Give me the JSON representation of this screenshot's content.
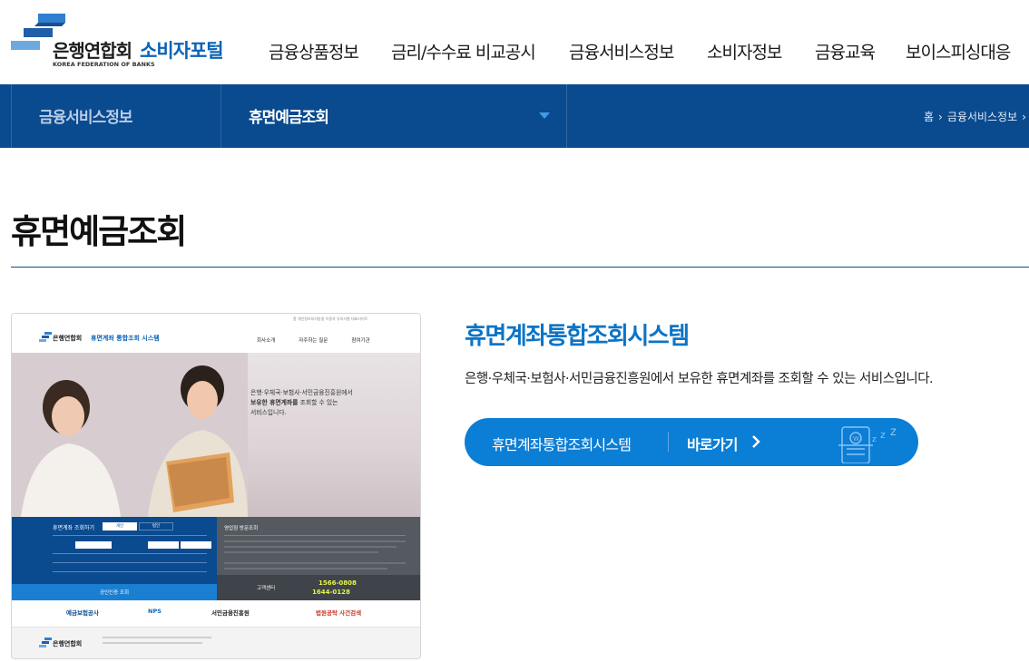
{
  "header": {
    "logo_kr": "은행연합회",
    "logo_en": "KOREA FEDERATION OF BANKS",
    "portal": "소비자포털",
    "menu": [
      "금융상품정보",
      "금리/수수료 비교공시",
      "금융서비스정보",
      "소비자정보",
      "금융교육",
      "보이스피싱대응"
    ]
  },
  "subnav": {
    "section": "금융서비스정보",
    "current": "휴면예금조회",
    "breadcrumb": [
      "홈",
      "금융서비스정보"
    ]
  },
  "page": {
    "title": "휴면예금조회"
  },
  "thumbnail": {
    "top_links": "홈   개인정보처리방침   이용자 유의사항   대표사이트",
    "logo": "은행연합회",
    "system_name": "휴면계좌 통합조회 시스템",
    "menu": [
      "회사소개",
      "자주하는 질문",
      "참여기관"
    ],
    "hero_line1": "은행·우체국·보험사·서민금융진흥원에서",
    "hero_line2_bold": "보유한 휴면계좌를",
    "hero_line2_rest": " 조회할 수 있는",
    "hero_line3": "서비스입니다.",
    "lookup_title": "휴면계좌 조회하기",
    "lookup_tab_personal": "개인",
    "lookup_tab_corp": "법인",
    "visit_title": "영업점 방문조회",
    "cert_button": "공인인증 조회",
    "cs_label": "고객센터",
    "cs_phone1": "1566-0808",
    "cs_phone2": "1644-0128",
    "partners": [
      "예금보험공사",
      "NPS",
      "서민금융진흥원",
      "법원공탁 사건검색"
    ],
    "footer_logo": "은행연합회"
  },
  "content": {
    "system_title": "휴면계좌통합조회시스템",
    "description": "은행·우체국·보험사·서민금융진흥원에서 보유한 휴면계좌를 조회할 수 있는 서비스입니다.",
    "button_name": "휴면계좌통합조회시스템",
    "button_label": "바로가기"
  },
  "colors": {
    "brand": "#0b63b6",
    "nav_bg": "#0a4a8f",
    "accent": "#0b7ed6"
  }
}
